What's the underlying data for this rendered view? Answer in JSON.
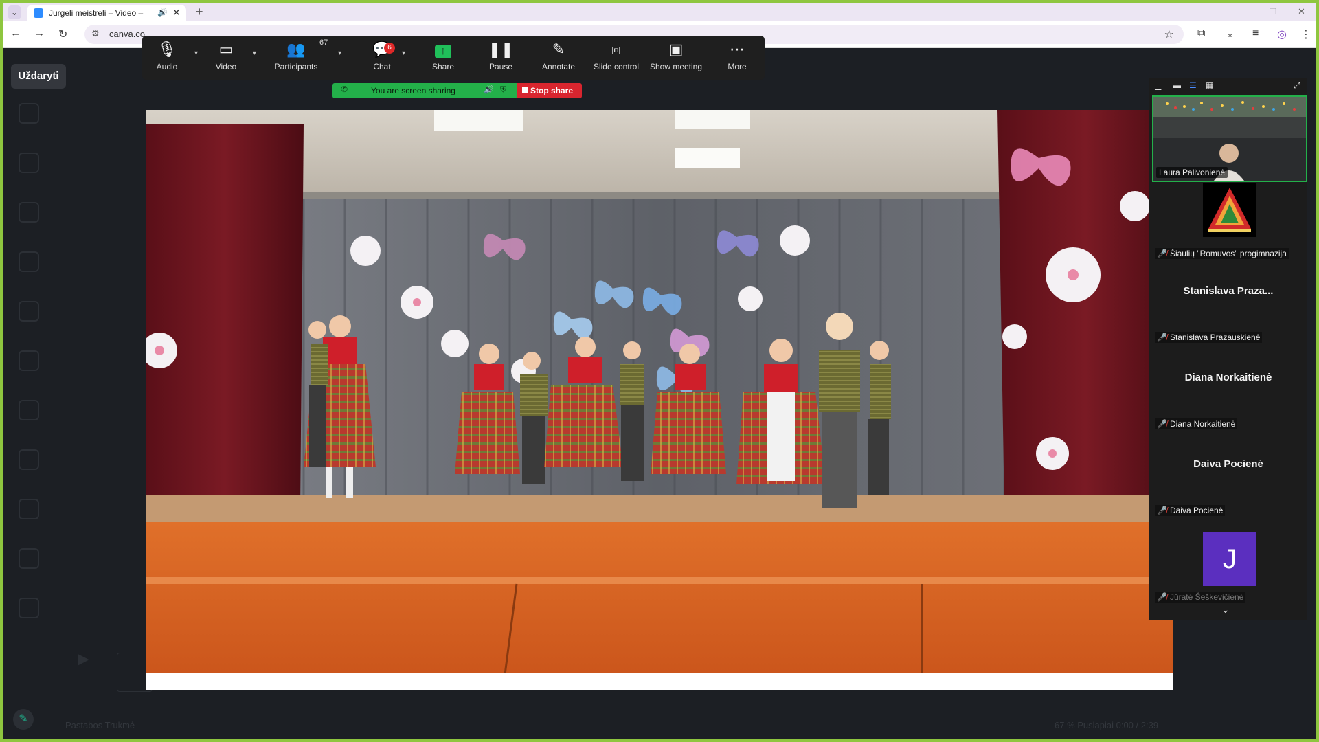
{
  "browser": {
    "tab_title": "Jurgeli meistreli – Video – ...",
    "tab_new": "+",
    "url": "canva.co",
    "window_controls": [
      "–",
      "☐",
      "✕"
    ]
  },
  "canva": {
    "close_label": "Uždaryti",
    "bottom_left": "Pastabos   Trukmė",
    "bottom_right": "67 %   Puslapiai   0:00 / 2:39"
  },
  "zoom_toolbar": {
    "audio": "Audio",
    "video": "Video",
    "participants": "Participants",
    "participants_count": "67",
    "chat": "Chat",
    "chat_badge": "6",
    "share": "Share",
    "pause": "Pause",
    "annotate": "Annotate",
    "slide_control": "Slide control",
    "show_meeting": "Show meeting",
    "more": "More"
  },
  "sharing": {
    "status": "You are screen sharing",
    "stop": "Stop share"
  },
  "panel": {
    "tiles": [
      {
        "type": "video",
        "name": "Laura Palivonienė"
      },
      {
        "type": "logo",
        "name": "Šiaulių \"Romuvos\" progimnazija"
      },
      {
        "type": "text",
        "big": "Stanislava  Praza...",
        "name": "Stanislava Prazauskienė"
      },
      {
        "type": "text",
        "big": "Diana Norkaitienė",
        "name": "Diana Norkaitienė"
      },
      {
        "type": "text",
        "big": "Daiva Pocienė",
        "name": "Daiva Pocienė"
      },
      {
        "type": "avatar",
        "initial": "J",
        "name": "Jūratė Šeškevičienė"
      }
    ]
  },
  "colors": {
    "zoom_green": "#23b04a",
    "stop_red": "#d8252f",
    "chat_badge": "#e02828",
    "frame_green": "#8ec63f"
  }
}
